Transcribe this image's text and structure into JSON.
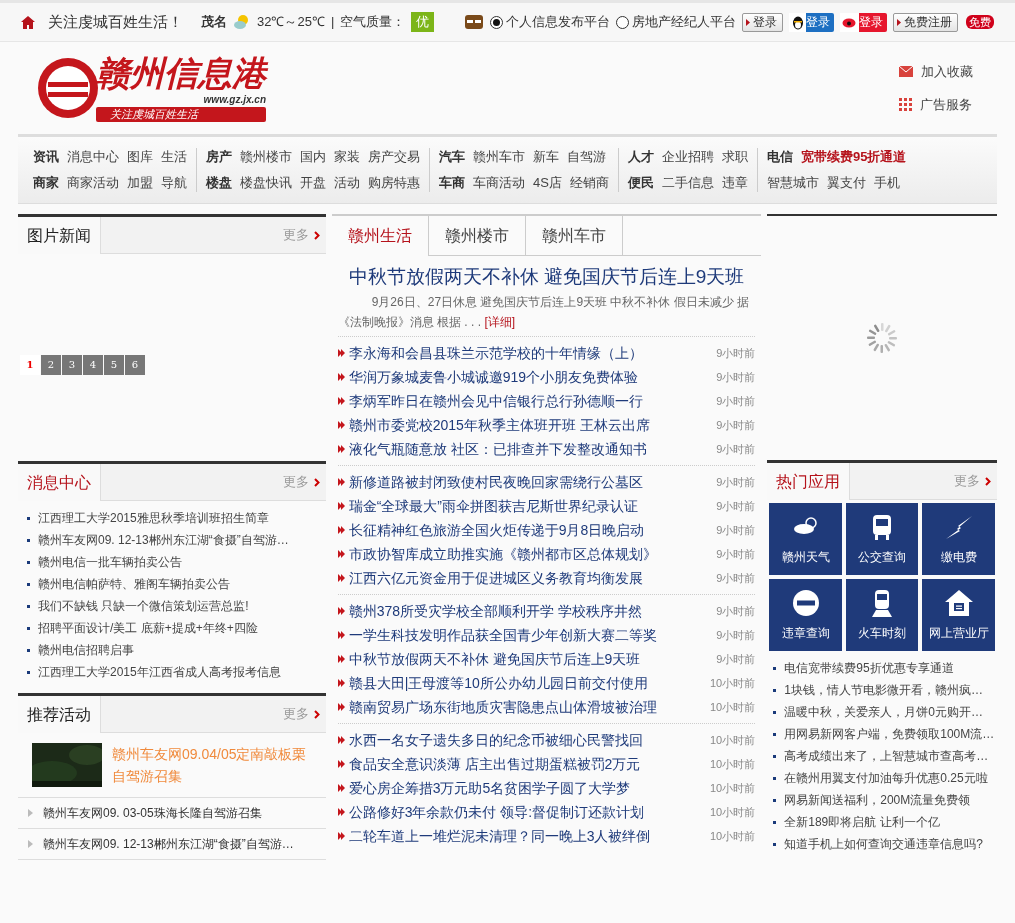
{
  "top_bar": {
    "slogan": "关注虔城百姓生活！",
    "city": "茂名",
    "temperature": "32℃～25℃",
    "separator": "|",
    "air_label": "空气质量：",
    "air_quality": "优",
    "platforms": [
      {
        "label": "个人信息发布平台",
        "selected": true
      },
      {
        "label": "房地产经纪人平台",
        "selected": false
      }
    ],
    "buttons": [
      {
        "kind": "plain",
        "label": "登录"
      },
      {
        "kind": "qq",
        "label": "登录"
      },
      {
        "kind": "weibo",
        "label": "登录"
      },
      {
        "kind": "plain",
        "label": "免费注册"
      }
    ],
    "badge": "免费"
  },
  "header": {
    "logo": {
      "name": "赣州信息港",
      "url": "www.gz.jx.cn",
      "tagline": "关注虔城百姓生活"
    },
    "links": [
      {
        "kind": "bookmark",
        "label": "加入收藏"
      },
      {
        "kind": "ads",
        "label": "广告服务"
      }
    ]
  },
  "nav": [
    [
      [
        {
          "kind": "head",
          "text": "资讯"
        },
        {
          "kind": "link",
          "text": "消息中心"
        },
        {
          "kind": "link",
          "text": "图库"
        },
        {
          "kind": "link",
          "text": "生活"
        }
      ],
      [
        {
          "kind": "head",
          "text": "商家"
        },
        {
          "kind": "link",
          "text": "商家活动"
        },
        {
          "kind": "link",
          "text": "加盟"
        },
        {
          "kind": "link",
          "text": "导航"
        }
      ]
    ],
    [
      [
        {
          "kind": "head",
          "text": "房产"
        },
        {
          "kind": "link",
          "text": "赣州楼市"
        },
        {
          "kind": "link",
          "text": "国内"
        },
        {
          "kind": "link",
          "text": "家装"
        },
        {
          "kind": "link",
          "text": "房产交易"
        }
      ],
      [
        {
          "kind": "head",
          "text": "楼盘"
        },
        {
          "kind": "link",
          "text": "楼盘快讯"
        },
        {
          "kind": "link",
          "text": "开盘"
        },
        {
          "kind": "link",
          "text": "活动"
        },
        {
          "kind": "link",
          "text": "购房特惠"
        }
      ]
    ],
    [
      [
        {
          "kind": "head",
          "text": "汽车"
        },
        {
          "kind": "link",
          "text": "赣州车市"
        },
        {
          "kind": "link",
          "text": "新车"
        },
        {
          "kind": "link",
          "text": "自驾游"
        }
      ],
      [
        {
          "kind": "head",
          "text": "车商"
        },
        {
          "kind": "link",
          "text": "车商活动"
        },
        {
          "kind": "link",
          "text": "4S店"
        },
        {
          "kind": "link",
          "text": "经销商"
        }
      ]
    ],
    [
      [
        {
          "kind": "head",
          "text": "人才"
        },
        {
          "kind": "link",
          "text": "企业招聘"
        },
        {
          "kind": "link",
          "text": "求职"
        }
      ],
      [
        {
          "kind": "head",
          "text": "便民"
        },
        {
          "kind": "link",
          "text": "二手信息"
        },
        {
          "kind": "link",
          "text": "违章"
        }
      ]
    ],
    [
      [
        {
          "kind": "head",
          "text": "电信"
        },
        {
          "kind": "promo",
          "text": "宽带续费95折通道"
        }
      ],
      [
        {
          "kind": "link",
          "text": "智慧城市"
        },
        {
          "kind": "link",
          "text": "翼支付"
        },
        {
          "kind": "link",
          "text": "手机"
        }
      ]
    ]
  ],
  "photo_news": {
    "title": "图片新闻",
    "highlighted": false,
    "more": "更多",
    "pages": [
      {
        "label": "1",
        "selected": true
      },
      {
        "label": "2",
        "selected": false
      },
      {
        "label": "3",
        "selected": false
      },
      {
        "label": "4",
        "selected": false
      },
      {
        "label": "5",
        "selected": false
      },
      {
        "label": "6",
        "selected": false
      }
    ]
  },
  "messages": {
    "title": "消息中心",
    "highlighted": true,
    "more": "更多",
    "items": [
      "江西理工大学2015雅思秋季培训班招生简章",
      "赣州车友网09. 12-13郴州东江湖“食摄”自驾游…",
      "赣州电信一批车辆拍卖公告",
      "赣州电信帕萨特、雅阁车辆拍卖公告",
      "我们不缺钱 只缺一个微信策划运营总监!",
      "招聘平面设计/美工 底薪+提成+年终+四险",
      "赣州电信招聘启事",
      "江西理工大学2015年江西省成人高考报考信息"
    ]
  },
  "activities": {
    "title": "推荐活动",
    "highlighted": false,
    "more": "更多",
    "featured": {
      "kind": "picture",
      "title": "赣州车友网09.04/05定南敲板栗自驾游召集"
    },
    "items": [
      "赣州车友网09. 03-05珠海长隆自驾游召集",
      "赣州车友网09. 12-13郴州东江湖“食摄”自驾游…"
    ]
  },
  "center": {
    "tabs": [
      {
        "label": "赣州生活",
        "selected": true
      },
      {
        "label": "赣州楼市",
        "selected": false
      },
      {
        "label": "赣州车市",
        "selected": false
      }
    ],
    "headline": "中秋节放假两天不补休 避免国庆节后连上9天班",
    "summary": "9月26日、27日休息 避免国庆节后连上9天班 中秋不补休 假日未减少 据《法制晚报》消息 根据 . . .",
    "detail_link": "[详细]",
    "groups": [
      [
        {
          "title": "李永海和会昌县珠兰示范学校的十年情缘（上）",
          "time": "9小时前"
        },
        {
          "title": "华润万象城麦鲁小城诚邀919个小朋友免费体验",
          "time": "9小时前"
        },
        {
          "title": "李炳军昨日在赣州会见中信银行总行孙德顺一行",
          "time": "9小时前"
        },
        {
          "title": "赣州市委党校2015年秋季主体班开班 王林云出席",
          "time": "9小时前"
        },
        {
          "title": "液化气瓶随意放 社区：已排查并下发整改通知书",
          "time": "9小时前"
        }
      ],
      [
        {
          "title": "新修道路被封闭致使村民夜晚回家需绕行公墓区",
          "time": "9小时前"
        },
        {
          "title": "瑞金“全球最大”雨伞拼图获吉尼斯世界纪录认证",
          "time": "9小时前"
        },
        {
          "title": "长征精神红色旅游全国火炬传递于9月8日晚启动",
          "time": "9小时前"
        },
        {
          "title": "市政协智库成立助推实施《赣州都市区总体规划》",
          "time": "9小时前"
        },
        {
          "title": "江西六亿元资金用于促进城区义务教育均衡发展",
          "time": "9小时前"
        }
      ],
      [
        {
          "title": "赣州378所受灾学校全部顺利开学 学校秩序井然",
          "time": "9小时前"
        },
        {
          "title": "一学生科技发明作品获全国青少年创新大赛二等奖",
          "time": "9小时前"
        },
        {
          "title": "中秋节放假两天不补休 避免国庆节后连上9天班",
          "time": "9小时前"
        },
        {
          "title": "赣县大田|王母渡等10所公办幼儿园日前交付使用",
          "time": "10小时前"
        },
        {
          "title": "赣南贸易广场东街地质灾害隐患点山体滑坡被治理",
          "time": "10小时前"
        }
      ],
      [
        {
          "title": "水西一名女子遗失多日的纪念币被细心民警找回",
          "time": "10小时前"
        },
        {
          "title": "食品安全意识淡薄 店主出售过期蛋糕被罚2万元",
          "time": "10小时前"
        },
        {
          "title": "爱心房企筹措3万元助5名贫困学子圆了大学梦",
          "time": "10小时前"
        },
        {
          "title": "公路修好3年余款仍未付 领导:督促制订还款计划",
          "time": "10小时前"
        },
        {
          "title": "二轮车道上一堆烂泥未清理？同一晚上3人被绊倒",
          "time": "10小时前"
        }
      ]
    ]
  },
  "hot_apps": {
    "title": "热门应用",
    "highlighted": true,
    "more": "更多",
    "apps": [
      {
        "kind": "weather",
        "label": "赣州天气"
      },
      {
        "kind": "bus",
        "label": "公交查询"
      },
      {
        "kind": "power",
        "label": "缴电费"
      },
      {
        "kind": "violation",
        "label": "违章查询"
      },
      {
        "kind": "train",
        "label": "火车时刻"
      },
      {
        "kind": "hall",
        "label": "网上营业厅"
      }
    ],
    "items": [
      "电信宽带续费95折优惠专享通道",
      "1块钱，情人节电影微开看，赣州疯…",
      "温暖中秋，关爱亲人，月饼0元购开…",
      "用网易新网客户端，免费领取100M流…",
      "高考成绩出来了，上智慧城市查高考…",
      "在赣州用翼支付加油每升优惠0.25元啦",
      "网易新闻送福利，200M流量免费领",
      "全新189即将启航 让利一个亿",
      "知道手机上如何查询交通违章信息吗?"
    ]
  }
}
